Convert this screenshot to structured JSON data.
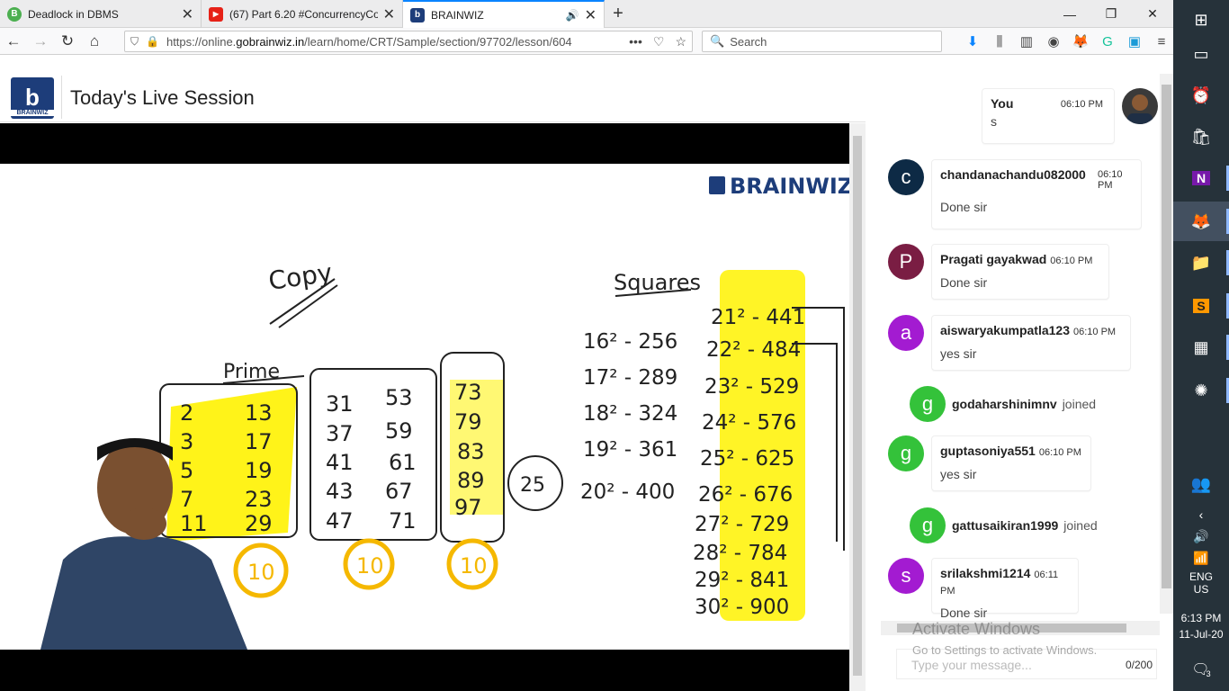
{
  "browser": {
    "tabs": [
      {
        "title": "Deadlock in DBMS",
        "favicon_color": "#4caf50",
        "favicon_letter": "B",
        "active": false,
        "audio": false
      },
      {
        "title": "(67) Part 6.20 #ConcurrencyCor",
        "favicon_color": "#e62117",
        "favicon_letter": "▶",
        "active": false,
        "audio": false
      },
      {
        "title": "BRAINWIZ",
        "favicon_color": "#1d3d7a",
        "favicon_letter": "b",
        "active": true,
        "audio": true
      }
    ],
    "url_prefix": "https://online.",
    "url_domain": "gobrainwiz.in",
    "url_path": "/learn/home/CRT/Sample/section/97702/lesson/604",
    "search_placeholder": "Search"
  },
  "page": {
    "logo_text": "BRAINWIZ",
    "title": "Today's Live Session",
    "board_brand": "BRAINWIZ"
  },
  "board_notes": {
    "copy": "Copy",
    "prime_label": "Prime",
    "squares_label": "Squares",
    "prime_col1": [
      "2",
      "3",
      "5",
      "7",
      "11"
    ],
    "prime_col2": [
      "13",
      "17",
      "19",
      "23",
      "29"
    ],
    "prime_col3": [
      "31",
      "37",
      "41",
      "43",
      "47"
    ],
    "prime_col4": [
      "53",
      "59",
      "61",
      "67",
      "71"
    ],
    "prime_col5": [
      "73",
      "79",
      "83",
      "89",
      "97"
    ],
    "count_marks": [
      "10",
      "10",
      "10"
    ],
    "circled": "25",
    "squares_left": [
      "16² - 256",
      "17² - 289",
      "18² - 324",
      "19² - 361",
      "20² - 400"
    ],
    "squares_right": [
      "21² - 441",
      "22² - 484",
      "23² - 529",
      "24² - 576",
      "25² - 625",
      "26² - 676",
      "27² - 729",
      "28² - 784",
      "29² - 841",
      "30² - 900"
    ]
  },
  "chat": {
    "messages": [
      {
        "type": "self",
        "name": "You",
        "time": "06:10 PM",
        "text": "s"
      },
      {
        "type": "msg",
        "avatar": "c",
        "color": "#0d2a45",
        "name": "chandanachandu082000",
        "time": "06:10 PM",
        "text": "Done sir"
      },
      {
        "type": "msg",
        "avatar": "P",
        "color": "#7a1d43",
        "name": "Pragati gayakwad",
        "time": "06:10 PM",
        "text": "Done sir"
      },
      {
        "type": "msg",
        "avatar": "a",
        "color": "#a31bd1",
        "name": "aiswaryakumpatla123",
        "time": "06:10 PM",
        "text": "yes sir"
      },
      {
        "type": "join",
        "avatar": "g",
        "color": "#34c23a",
        "name": "godaharshinimnv",
        "text": "joined"
      },
      {
        "type": "msg",
        "avatar": "g",
        "color": "#34c23a",
        "name": "guptasoniya551",
        "time": "06:10 PM",
        "text": "yes sir"
      },
      {
        "type": "join",
        "avatar": "g",
        "color": "#34c23a",
        "name": "gattusaikiran1999",
        "text": "joined"
      },
      {
        "type": "msg",
        "avatar": "s",
        "color": "#a31bd1",
        "name": "srilakshmi1214",
        "time": "06:11 PM",
        "text": "Done sir"
      }
    ],
    "input_placeholder": "Type your message...",
    "char_count": "0/200"
  },
  "watermark": {
    "line1": "Activate Windows",
    "line2": "Go to Settings to activate Windows."
  },
  "taskbar": {
    "lang1": "ENG",
    "lang2": "US",
    "time": "6:13 PM",
    "date": "11-Jul-20",
    "notif_count": "3"
  }
}
